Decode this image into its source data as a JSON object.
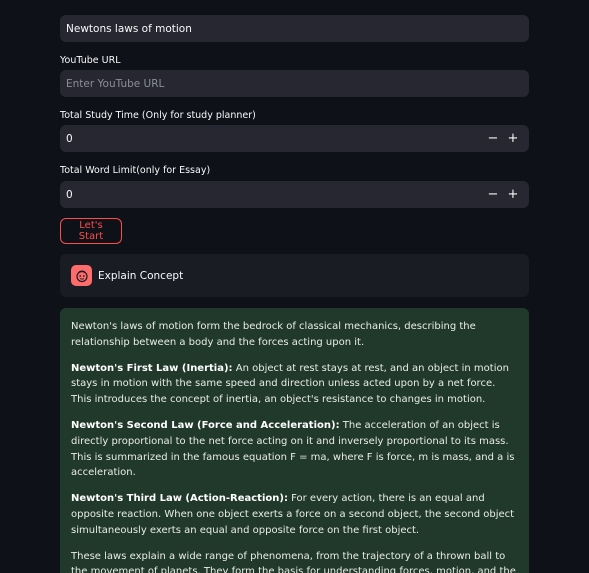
{
  "topic": {
    "value": "Newtons laws of motion"
  },
  "youtube": {
    "label": "YouTube URL",
    "placeholder": "Enter YouTube URL"
  },
  "study_time": {
    "label": "Total Study Time (Only for study planner)",
    "value": "0",
    "minus": "−",
    "plus": "+"
  },
  "word_limit": {
    "label": "Total Word Limit(only for Essay)",
    "value": "0",
    "minus": "−",
    "plus": "+"
  },
  "start_button": {
    "label": "Let's Start"
  },
  "concept": {
    "title": "Explain Concept"
  },
  "answer": {
    "intro": "Newton's laws of motion form the bedrock of classical mechanics, describing the relationship between a body and the forces acting upon it.",
    "first_law_title": "Newton's First Law (Inertia):",
    "first_law_text": " An object at rest stays at rest, and an object in motion stays in motion with the same speed and direction unless acted upon by a net force. This introduces the concept of inertia, an object's resistance to changes in motion.",
    "second_law_title": "Newton's Second Law (Force and Acceleration):",
    "second_law_text": " The acceleration of an object is directly proportional to the net force acting on it and inversely proportional to its mass. This is summarized in the famous equation F = ma, where F is force, m is mass, and a is acceleration.",
    "third_law_title": "Newton's Third Law (Action-Reaction):",
    "third_law_text": " For every action, there is an equal and opposite reaction. When one object exerts a force on a second object, the second object simultaneously exerts an equal and opposite force on the first object.",
    "closing": "These laws explain a wide range of phenomena, from the trajectory of a thrown ball to the movement of planets. They form the basis for understanding forces, motion, and the interaction of objects in our universe."
  },
  "colors": {
    "background": "#0e1117",
    "input_bg": "#262730",
    "accent": "#ff4b4b",
    "answer_bg": "#21392a"
  }
}
